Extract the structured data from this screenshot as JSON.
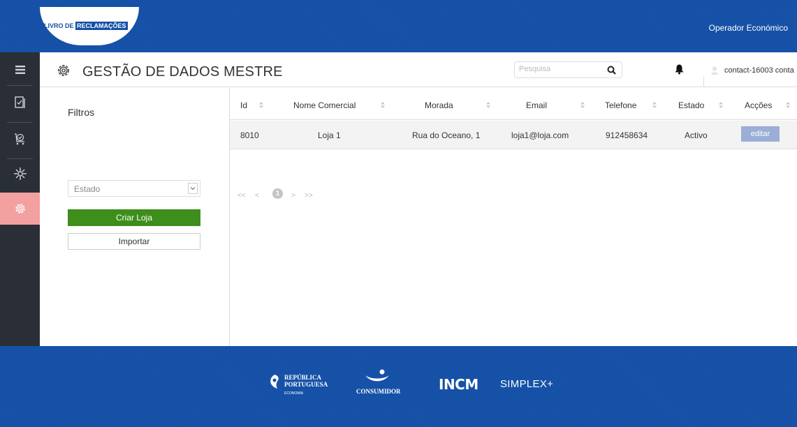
{
  "brand": {
    "logo_part1": "LIVRO DE",
    "logo_part2": "RECLAMAÇÕES"
  },
  "topbar": {
    "operator_label": "Operador Económico"
  },
  "sidebar": {
    "items": [
      {
        "icon": "hamburger-menu-icon",
        "active": false
      },
      {
        "icon": "book-check-icon",
        "active": false
      },
      {
        "icon": "shopping-cart-check-icon",
        "active": false
      },
      {
        "icon": "network-hub-icon",
        "active": false
      },
      {
        "icon": "gear-icon",
        "active": true
      }
    ]
  },
  "header": {
    "title": "GESTÃO DE DADOS MESTRE",
    "search_placeholder": "Pesquisa",
    "user_name": "contact-16003 conta"
  },
  "filters": {
    "title": "Filtros",
    "status_select": "Estado",
    "create_button": "Criar Loja",
    "import_button": "Importar"
  },
  "table": {
    "columns": [
      "Id",
      "Nome Comercial",
      "Morada",
      "Email",
      "Telefone",
      "Estado",
      "Acções"
    ],
    "rows": [
      {
        "id": "8010",
        "nome": "Loja 1",
        "morada": "Rua do Oceano, 1",
        "email": "loja1@loja.com",
        "telefone": "912458634",
        "estado": "Activo",
        "action": "editar"
      }
    ]
  },
  "pagination": {
    "first": "<<",
    "prev": "<",
    "current": "1",
    "next": ">",
    "last": ">>"
  },
  "footer": {
    "republica_line1": "REPÚBLICA",
    "republica_line2": "PORTUGUESA",
    "republica_sub": "ECONOMIA",
    "consumidor": "CONSUMIDOR",
    "incm": "INCM",
    "simplex": "SIMPLEX+"
  },
  "colors": {
    "brand_blue": "#1450a6",
    "sidebar_dark": "#2a2e36",
    "sidebar_active": "#f2a0a0",
    "create_green": "#3d8e1a",
    "edit_button": "#9aaed6"
  }
}
